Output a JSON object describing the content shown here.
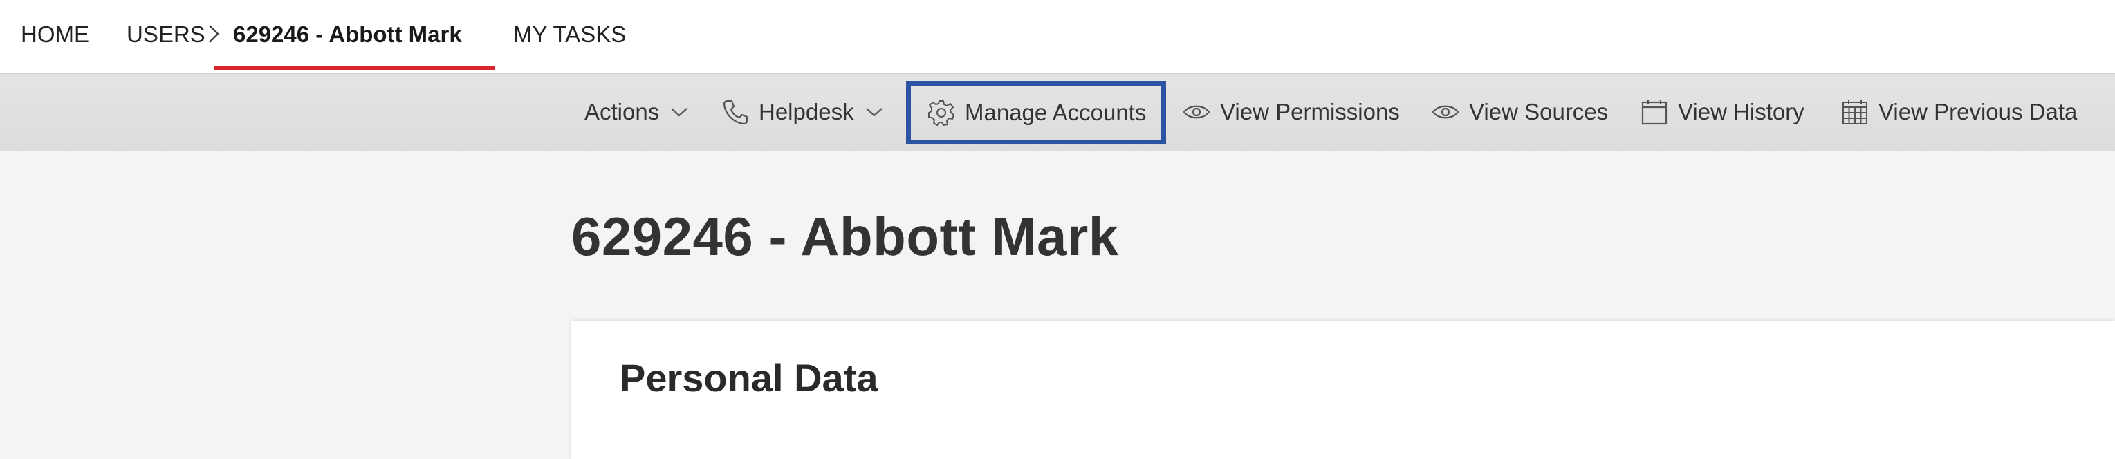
{
  "nav": {
    "home": "HOME",
    "users": "USERS",
    "current": "629246 - Abbott Mark",
    "tasks": "MY TASKS",
    "active_color": "#d9262b"
  },
  "toolbar": {
    "actions": {
      "label": "Actions",
      "icon": "chevron-down-icon"
    },
    "helpdesk": {
      "label": "Helpdesk",
      "icon": "phone-icon"
    },
    "manage_accounts": {
      "label": "Manage Accounts",
      "icon": "gear-icon",
      "highlight_color": "#2d53a3"
    },
    "view_permissions": {
      "label": "View Permissions",
      "icon": "eye-icon"
    },
    "view_sources": {
      "label": "View Sources",
      "icon": "eye-icon"
    },
    "view_history": {
      "label": "View History",
      "icon": "calendar-icon"
    },
    "view_previous_data": {
      "label": "View Previous Data",
      "icon": "calendar-grid-icon"
    }
  },
  "page": {
    "title": "629246 - Abbott Mark"
  },
  "card": {
    "title": "Personal Data"
  }
}
